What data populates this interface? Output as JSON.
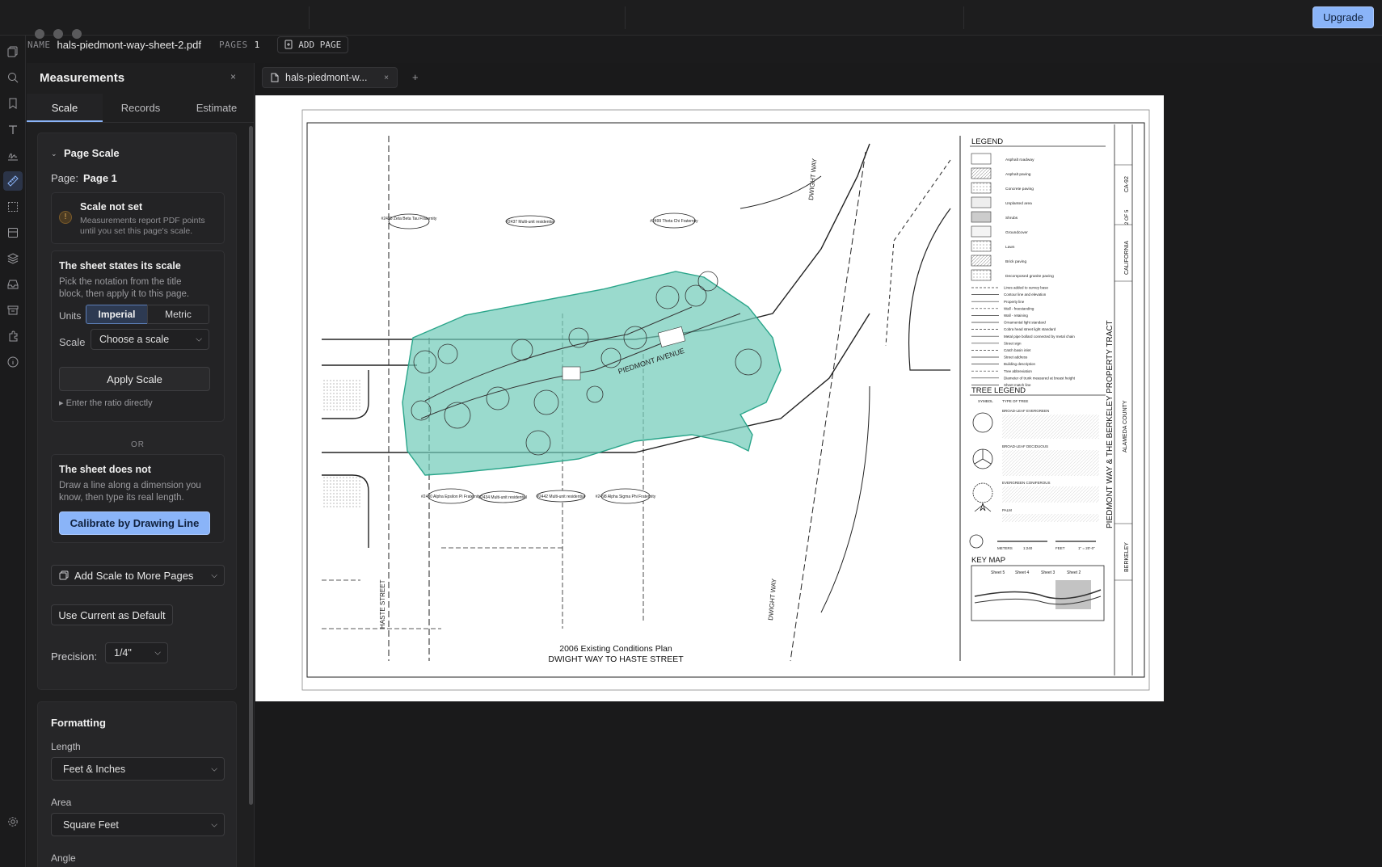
{
  "topbar": {
    "upgrade_label": "Upgrade"
  },
  "file": {
    "name_label": "NAME",
    "name": "hals-piedmont-way-sheet-2.pdf",
    "pages_label": "PAGES",
    "pages": "1",
    "add_page": "ADD PAGE"
  },
  "panel": {
    "title": "Measurements",
    "close": "×",
    "tabs": [
      "Scale",
      "Records",
      "Estimate"
    ],
    "page_scale": {
      "heading": "Page Scale",
      "page_label": "Page:",
      "page_value": "Page 1",
      "warning_title": "Scale not set",
      "warning_text_1": "Measurements report PDF points",
      "warning_text_2": "until you set this page's scale.",
      "states_title": "The sheet states its scale",
      "states_text_1": "Pick the notation from the title",
      "states_text_2": "block, then apply it to this page.",
      "units_label": "Units",
      "unit_imperial": "Imperial",
      "unit_metric": "Metric",
      "scale_label": "Scale",
      "scale_placeholder": "Choose a scale",
      "apply": "Apply Scale",
      "ratio_link": "Enter the ratio directly",
      "or": "OR",
      "not_title": "The sheet does not",
      "not_text_1": "Draw a line along a dimension you",
      "not_text_2": "know, then type its real length.",
      "calibrate": "Calibrate by Drawing Line",
      "add_scale": "Add Scale to More Pages",
      "use_default": "Use Current as Default",
      "precision_label": "Precision:",
      "precision_value": "1/4\""
    },
    "formatting": {
      "heading": "Formatting",
      "length_label": "Length",
      "length_value": "Feet & Inches",
      "area_label": "Area",
      "area_value": "Square Feet",
      "angle_label": "Angle"
    }
  },
  "viewer": {
    "tab_label": "hals-piedmont-w...",
    "tab_close": "×",
    "new_tab": "+"
  },
  "drawing": {
    "legend_title": "LEGEND",
    "legend_items": [
      "Asphalt roadway",
      "Asphalt paving",
      "Concrete paving",
      "Unplanted area",
      "Shrubs",
      "Groundcover",
      "Lawn",
      "Brick paving",
      "Decomposed granite paving"
    ],
    "legend_lines": [
      "Lines added to survey base",
      "Contour line and elevation",
      "Property line",
      "Wall - freestanding",
      "Wall - retaining",
      "Ornamental light standard",
      "Cobra head street light standard",
      "Metal pipe bollard connected by metal chain",
      "Street sign",
      "Catch basin inlet",
      "Street address",
      "Building description",
      "Tree abbreviation",
      "Diameter of trunk measured at breast height",
      "Sheet match line"
    ],
    "tree_legend_title": "TREE LEGEND",
    "tree_cols": [
      "SYMBOL",
      "TYPE OF TREE"
    ],
    "tree_groups": [
      "BROAD-LEAF EVERGREEN",
      "BROAD-LEAF DECIDUOUS",
      "EVERGREEN CONIFEROUS",
      "PALM"
    ],
    "scale_text": [
      "METERS",
      "1:240",
      "FEET",
      "1\" = 20'-0\""
    ],
    "keymap_title": "KEY MAP",
    "keymap_sheets": [
      "Sheet 5",
      "Sheet 4",
      "Sheet 3",
      "Sheet 2"
    ],
    "plan_title_1": "2006 Existing Conditions Plan",
    "plan_title_2": "DWIGHT WAY TO HASTE STREET",
    "street_piedmont": "PIEDMONT AVENUE",
    "street_dwight": "DWIGHT WAY",
    "street_haste": "HASTE STREET",
    "buildings_top": [
      "#2425 Zeta Beta Tau Fraternity",
      "#2437 Multi-unit residential",
      "#2499 Theta Chi Fraternity"
    ],
    "buildings_bottom": [
      "#2430 Alpha Epsilon Pi Fraternity",
      "#2434 Multi-unit residential",
      "#2442 Multi-unit residential",
      "#2498 Alpha Sigma Phi Fraternity"
    ],
    "title_block": "PIEDMONT WAY & THE BERKELEY PROPERTY TRACT",
    "title_block_sub": "ALAMEDA COUNTY",
    "state": "CALIFORNIA",
    "city": "BERKELEY",
    "sheet_no": "CA-92",
    "sheet_of": "2 OF 5",
    "colors": {
      "selection_fill": "#6fcbb8",
      "selection_stroke": "#2aa58a",
      "accent": "#8ab4f8"
    }
  }
}
